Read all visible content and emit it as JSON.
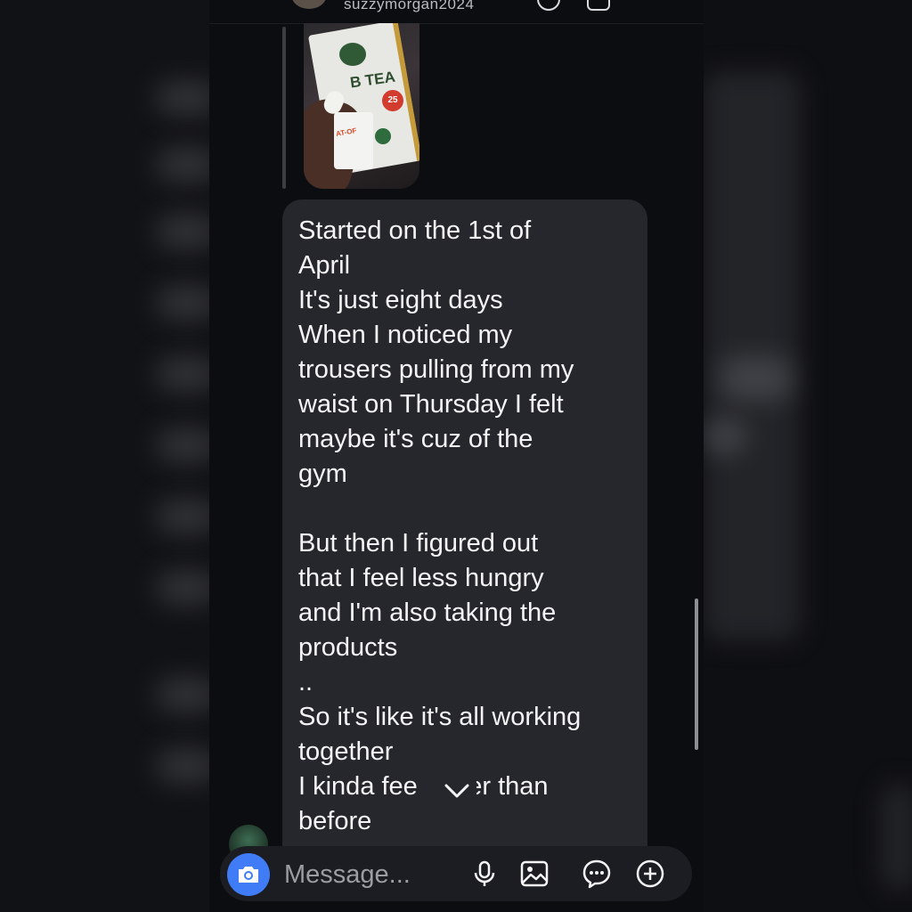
{
  "header": {
    "username": "suzzymorgan2024"
  },
  "message": {
    "image": {
      "label": "B TEA",
      "badge": "25",
      "cup_label": "AT-OF"
    },
    "text": "Started on the 1st of\nApril\nIt's just eight days\nWhen I noticed my\ntrousers pulling from my\nwaist on Thursday I felt\nmaybe it's cuz of the\ngym\n\nBut then I figured out\nthat I feel less hungry\nand I'm also taking the\nproducts\n..\nSo it's like it's all working\ntogether\nI kinda fee    nter than\nbefore"
  },
  "composer": {
    "placeholder": "Message...",
    "icons": [
      "camera-icon",
      "microphone-icon",
      "gallery-icon",
      "sticker-icon",
      "add-icon"
    ]
  },
  "colors": {
    "background": "#0c0d11",
    "bubble": "#26272c",
    "accent": "#3f7cf5",
    "text": "#f4f4f6"
  }
}
